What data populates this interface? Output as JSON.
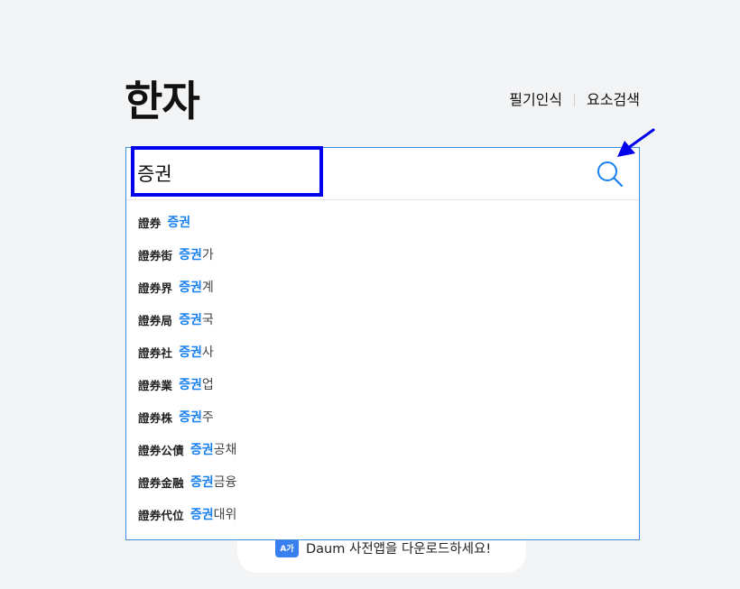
{
  "header": {
    "title": "한자",
    "links": [
      "필기인식",
      "요소검색"
    ]
  },
  "search": {
    "value": "증권",
    "placeholder": ""
  },
  "suggestions": [
    {
      "hanja": "證券",
      "match": "증권",
      "rest": ""
    },
    {
      "hanja": "證券街",
      "match": "증권",
      "rest": "가"
    },
    {
      "hanja": "證券界",
      "match": "증권",
      "rest": "계"
    },
    {
      "hanja": "證券局",
      "match": "증권",
      "rest": "국"
    },
    {
      "hanja": "證券社",
      "match": "증권",
      "rest": "사"
    },
    {
      "hanja": "證券業",
      "match": "증권",
      "rest": "업"
    },
    {
      "hanja": "證券株",
      "match": "증권",
      "rest": "주"
    },
    {
      "hanja": "證券公債",
      "match": "증권",
      "rest": " 공채"
    },
    {
      "hanja": "證券金融",
      "match": "증권",
      "rest": " 금융"
    },
    {
      "hanja": "證券代位",
      "match": "증권",
      "rest": " 대위"
    }
  ],
  "banner": {
    "icon_text": "A가",
    "text": "Daum 사전앱을 다운로드하세요!"
  },
  "colors": {
    "accent": "#1a80ee",
    "search_border": "#3c8fde",
    "highlight_box": "#0000ee",
    "background": "#f3f4f6"
  },
  "icons": {
    "search": "search-icon",
    "app": "dictionary-app-icon",
    "annotation": "arrow-pointer-icon"
  }
}
